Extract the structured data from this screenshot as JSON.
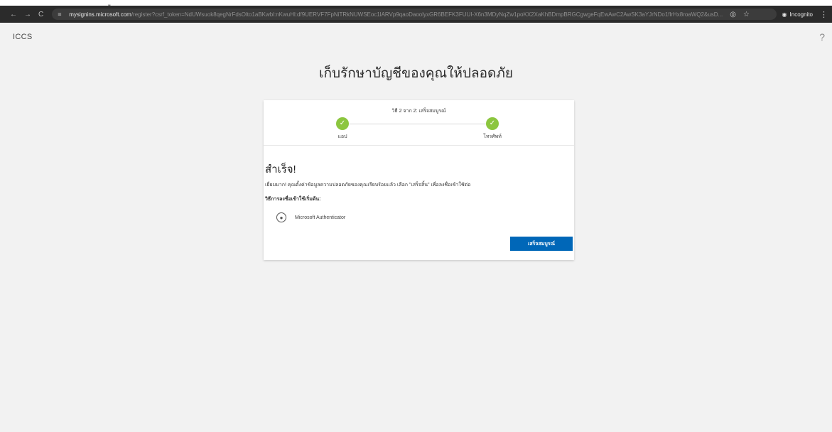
{
  "top_fragment": "ู",
  "browser": {
    "url_host": "mysignins.microsoft.com",
    "url_path": "/register?csrf_token=NdUWsuok8qegNrFdsOlto1aBKwbl:nKwuHl:df9UERVF7FpNiTRkNUWSEoc1lARVp9qaoDaoolyxGR6BEFK3FUUI-X6n3MDyNqZw1poKX2XaKhBDmpBRGCgwgeFqEwAwC2AwSK3aYJrNDo1flrHx8roaWQ2&usD...",
    "incognito_label": "Incognito"
  },
  "app": {
    "brand": "ICCS",
    "help_glyph": "?"
  },
  "page": {
    "title": "เก็บรักษาบัญชีของคุณให้ปลอดภัย"
  },
  "steps": {
    "header": "วิธี 2 จาก 2: เสร็จสมบูรณ์",
    "items": [
      {
        "label": "แอป",
        "complete": true
      },
      {
        "label": "โทรศัพท์",
        "complete": true
      }
    ]
  },
  "result": {
    "heading": "สำเร็จ!",
    "message_line1": "เยี่ยมมาก! คุณตั้งค่าข้อมูลความปลอดภัยของคุณเรียบร้อยแล้ว เลือก \"เสร็จสิ้น\" เพื่อลงชื่อเข้าใช้ต่อ",
    "message_line2": "วิธีการลงชื่อเข้าใช้เริ่มต้น:",
    "method": "Microsoft Authenticator",
    "done_button": "เสร็จสมบูรณ์"
  },
  "colors": {
    "accent": "#0067b8",
    "success": "#8cc63f",
    "page_bg": "#f2f2f2"
  }
}
